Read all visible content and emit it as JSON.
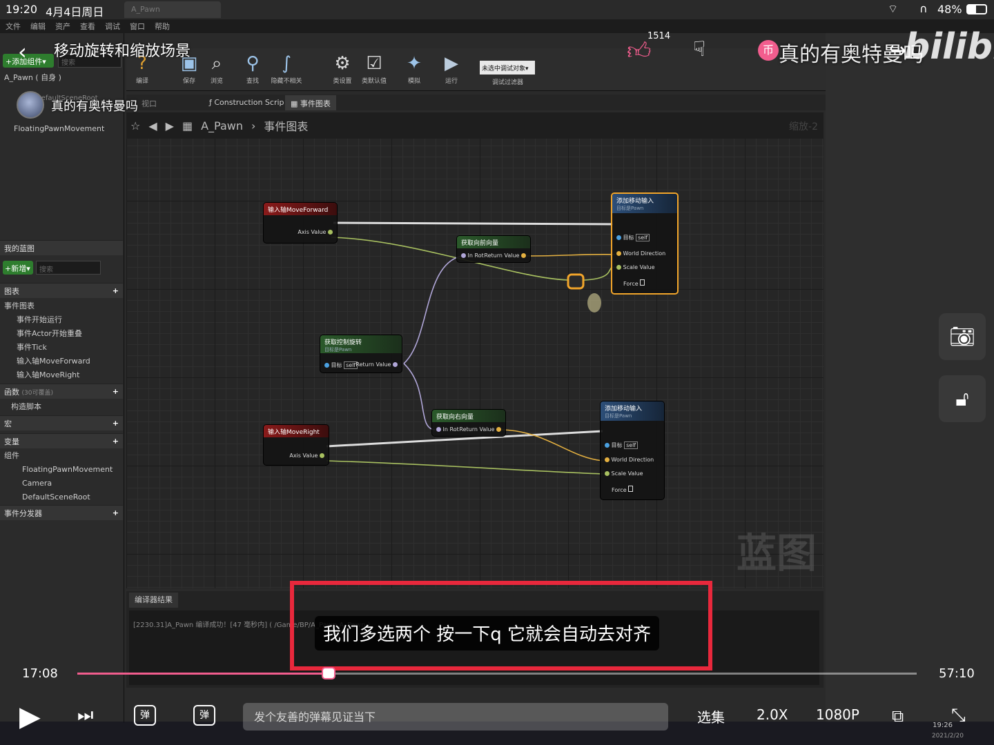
{
  "status_bar": {
    "time": "19:20",
    "date": "4月4日周日",
    "battery": "48%"
  },
  "ue": {
    "menu": [
      "文件",
      "编辑",
      "资产",
      "查看",
      "调试",
      "窗口",
      "帮助"
    ],
    "tab_title": "A_Pawn",
    "left_panel": {
      "add_component": "+添加组件▾",
      "search_placeholder": "搜索",
      "self_item": "A_Pawn ( 自身 )",
      "components": [
        "DefaultSceneRoot",
        "Camera",
        "FloatingPawnMovement"
      ],
      "my_blueprint": "我的蓝图",
      "new_btn": "+新增▾",
      "bp_search_placeholder": "搜索",
      "graphs_label": "图表",
      "event_graph_label": "事件图表",
      "events": [
        "事件开始运行",
        "事件Actor开始重叠",
        "事件Tick",
        "输入轴MoveForward",
        "输入轴MoveRight"
      ],
      "functions_label": "函数",
      "functions_count": "(30可覆盖)",
      "construction_script": "构造脚本",
      "macros_label": "宏",
      "variables_label": "变量",
      "components_label": "组件",
      "comp_list": [
        "FloatingPawnMovement",
        "Camera",
        "DefaultSceneRoot"
      ],
      "dispatchers_label": "事件分发器"
    },
    "toolbar": [
      {
        "label": "编译",
        "icon": "compile-icon"
      },
      {
        "label": "保存",
        "icon": "save-icon"
      },
      {
        "label": "浏览",
        "icon": "browse-icon"
      },
      {
        "label": "查找",
        "icon": "find-icon"
      },
      {
        "label": "隐藏不相关",
        "icon": "hide-unrelated-icon"
      },
      {
        "label": "类设置",
        "icon": "class-settings-icon"
      },
      {
        "label": "类默认值",
        "icon": "class-defaults-icon"
      },
      {
        "label": "模拟",
        "icon": "simulate-icon"
      },
      {
        "label": "运行",
        "icon": "play-icon"
      }
    ],
    "debug_select": "未选中调试对象▾",
    "debug_filter": "调试过滤器",
    "tabs": [
      "视口",
      "Construction Scrip",
      "事件图表"
    ],
    "breadcrumb": {
      "root": "A_Pawn",
      "sep": "›",
      "current": "事件图表"
    },
    "zoom": "缩放-2",
    "watermark": "蓝图",
    "compiler_tab": "编译器结果",
    "compiler_log": "[2230.31]A_Pawn 编译成功！[47 毫秒内] ( /Game/BP/A_Pawn.A_Pawn )",
    "nodes": {
      "mf_title": "输入轴MoveForward",
      "mr_title": "输入轴MoveRight",
      "axis_value": "Axis Value",
      "fwd_title": "获取向前向量",
      "right_title": "获取向右向量",
      "rot_title": "获取控制旋转",
      "rot_sub": "目标是Pawn",
      "in_rot": "In Rot",
      "return_value": "Return Value",
      "target": "目标",
      "self": "self",
      "add_title": "添加移动输入",
      "add_sub": "目标是Pawn",
      "world_dir": "World Direction",
      "scale_value": "Scale Value",
      "force": "Force"
    }
  },
  "bili": {
    "video_title": "移动旋转和缩放场景",
    "uploader": "真的有奥特曼吗",
    "likes": "1514",
    "danmaku_overlay": "真的有奥特曼吗",
    "subtitle": "我们多选两个 按一下q 它就会自动去对齐",
    "current_time": "17:08",
    "total_time": "57:10",
    "progress_fraction": 0.2996,
    "danmaku_placeholder": "发个友善的弹幕见证当下",
    "episodes_label": "选集",
    "speed_label": "2.0X",
    "quality_label": "1080P",
    "danmaku_btn": "弹",
    "logo": "bilibili"
  },
  "taskbar": {
    "time": "19:26",
    "date": "2021/2/20"
  },
  "colors": {
    "bili_pink": "#f25d8e",
    "highlight_red": "#e8283c",
    "node_select": "#f2a52a"
  }
}
